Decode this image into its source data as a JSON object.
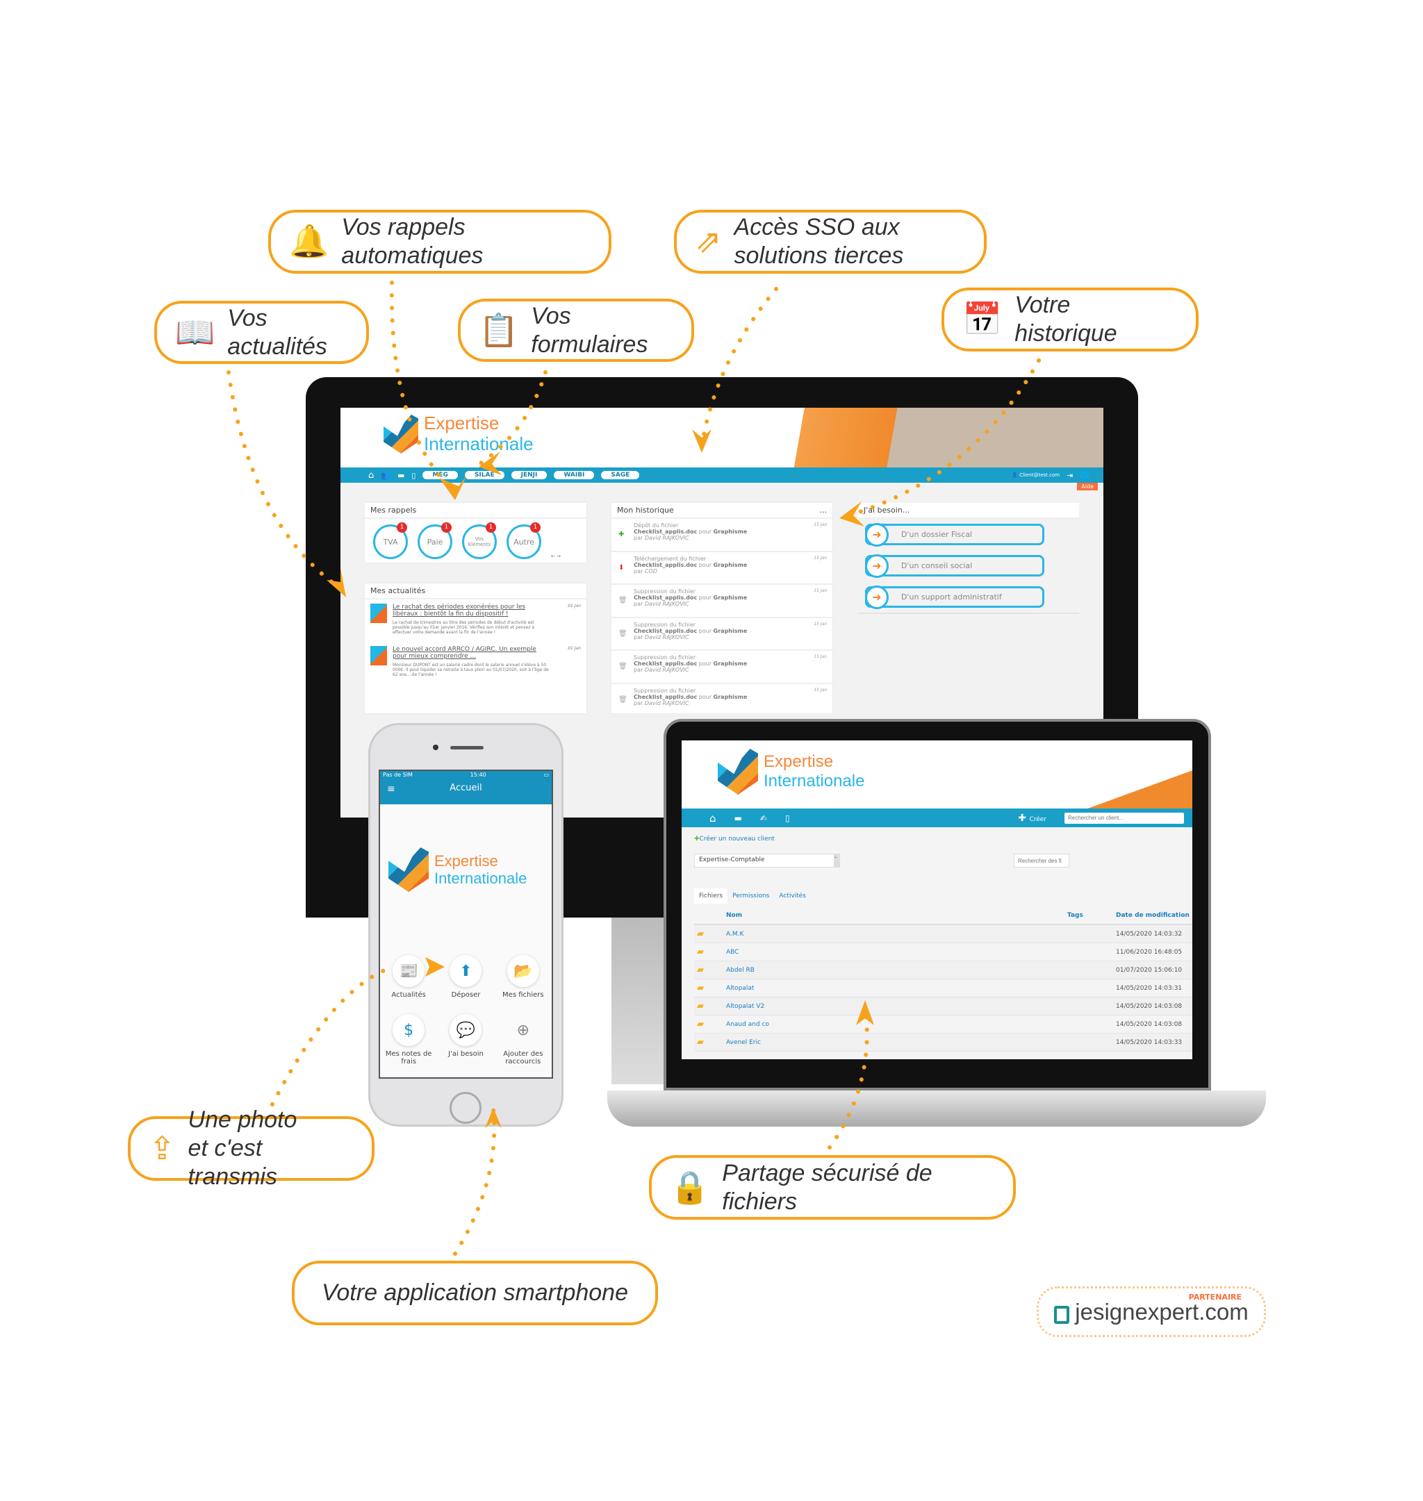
{
  "callouts": {
    "rappels": "Vos rappels automatiques",
    "sso": "Accès SSO aux solutions tierces",
    "actualites": "Vos actualités",
    "formulaires": "Vos formulaires",
    "historique": "Votre historique",
    "photo_line1": "Une photo",
    "photo_line2": "et c'est transmis",
    "partage": "Partage sécurisé de fichiers",
    "smartphone": "Votre application smartphone"
  },
  "icons": {
    "rappels": "bell-icon",
    "sso": "external-link-icon",
    "actualites": "open-book-icon",
    "formulaires": "clipboard-list-icon",
    "historique": "calendar-check-icon",
    "photo": "upload-icon",
    "partage": "padlock-icon"
  },
  "colors": {
    "accent": "#f7a21b",
    "primary": "#1a9fc8",
    "logo_orange": "#f5883a",
    "logo_blue": "#2bb6e6"
  },
  "brand": {
    "line1": "Expertise",
    "line2": "Internationale"
  },
  "partner": {
    "badge": "PARTENAIRE",
    "name": "jesignexpert.com"
  },
  "desktop": {
    "nav_pills": [
      "MEG",
      "SILAE",
      "JENJI",
      "WAIBI",
      "SAGE"
    ],
    "user_email": "Client@test.com",
    "help": "Aide",
    "rappels": {
      "title": "Mes rappels",
      "items": [
        {
          "label": "TVA",
          "count": "1"
        },
        {
          "label": "Paie",
          "count": "1"
        },
        {
          "label": "Vos Eléments",
          "count": "1"
        },
        {
          "label": "Autre",
          "count": "1"
        }
      ],
      "prev": "←",
      "next": "→"
    },
    "actualites": {
      "title": "Mes actualités",
      "items": [
        {
          "title": "Le rachat des périodes exonérées pour les libéraux : bientôt la fin du dispositif !",
          "date": "01 Jan",
          "body": "Le rachat de trimestres au titre des périodes de début d'activité est possible jusqu'au 01er janvier 2016. Vérifiez son intérêt et pensez à effectuer votre demande avant la fin de l'année !"
        },
        {
          "title": "Le nouvel accord ARRCO / AGIRC. Un exemple pour mieux comprendre ...",
          "date": "01 Jan",
          "body": "Monsieur DUPONT est un salarié cadre dont le salarie annuel s'élève à 50 000€. Il peut liquider sa retraite à taux plein au 01/07/2020, soit à l'âge de 62 ans....de l'année !"
        }
      ]
    },
    "historique": {
      "title": "Mon historique",
      "menu": "...",
      "items": [
        {
          "icon": "plus-icon",
          "action": "Dépôt du fichier",
          "file": "Checklist_applis.doc",
          "pour": "pour",
          "target": "Graphisme",
          "par": "par",
          "user": "David RAJKOVIC",
          "date": "15 Jan"
        },
        {
          "icon": "download-arrow-icon",
          "action": "Téléchargement du fichier",
          "file": "Checklist_applis.doc",
          "pour": "pour",
          "target": "Graphisme",
          "par": "par",
          "user": "COD",
          "date": "15 Jan"
        },
        {
          "icon": "trash-icon",
          "action": "Suppression du fichier",
          "file": "Checklist_applis.doc",
          "pour": "pour",
          "target": "Graphisme",
          "par": "par",
          "user": "David RAJKOVIC",
          "date": "15 Jan"
        },
        {
          "icon": "trash-icon",
          "action": "Suppression du fichier",
          "file": "Checklist_applis.doc",
          "pour": "pour",
          "target": "Graphisme",
          "par": "par",
          "user": "David RAJKOVIC",
          "date": "15 Jan"
        },
        {
          "icon": "trash-icon",
          "action": "Suppression du fichier",
          "file": "Checklist_applis.doc",
          "pour": "pour",
          "target": "Graphisme",
          "par": "par",
          "user": "David RAJKOVIC",
          "date": "15 Jan"
        },
        {
          "icon": "trash-icon",
          "action": "Suppression du fichier",
          "file": "Checklist_applis.doc",
          "pour": "pour",
          "target": "Graphisme",
          "par": "par",
          "user": "David RAJKOVIC",
          "date": "15 Jan"
        }
      ]
    },
    "besoin": {
      "title": "J'ai besoin...",
      "items": [
        "D'un dossier Fiscal",
        "D'un conseil social",
        "D'un support administratif"
      ]
    }
  },
  "phone": {
    "carrier": "Pas de SIM",
    "time": "15:40",
    "title": "Accueil",
    "shortcuts": [
      {
        "label": "Actualités",
        "icon": "newspaper-icon"
      },
      {
        "label": "Déposer",
        "icon": "file-upload-icon"
      },
      {
        "label": "Mes fichiers",
        "icon": "folder-open-icon"
      },
      {
        "label": "Mes notes de frais",
        "icon": "expense-file-icon"
      },
      {
        "label": "J'ai besoin",
        "icon": "chat-bubbles-icon"
      },
      {
        "label": "Ajouter des raccourcis",
        "icon": "plus-circle-icon"
      }
    ]
  },
  "laptop": {
    "create": "Créer",
    "search_client_placeholder": "Rechercher un client...",
    "new_client": "Créer un nouveau client",
    "select_value": "Expertise-Comptable",
    "search_files_placeholder": "Rechercher des fi",
    "tabs": [
      "Fichiers",
      "Permissions",
      "Activités"
    ],
    "columns": {
      "name": "Nom",
      "tags": "Tags",
      "date": "Date de modification"
    },
    "rows": [
      {
        "name": "A.M.K",
        "date": "14/05/2020 14:03:32"
      },
      {
        "name": "ABC",
        "date": "11/06/2020 16:48:05"
      },
      {
        "name": "Abdel RB",
        "date": "01/07/2020 15:06:10"
      },
      {
        "name": "Altopalat",
        "date": "14/05/2020 14:03:31"
      },
      {
        "name": "Altopalat V2",
        "date": "14/05/2020 14:03:08"
      },
      {
        "name": "Anaud and co",
        "date": "14/05/2020 14:03:08"
      },
      {
        "name": "Avenel Eric",
        "date": "14/05/2020 14:03:33"
      }
    ]
  }
}
